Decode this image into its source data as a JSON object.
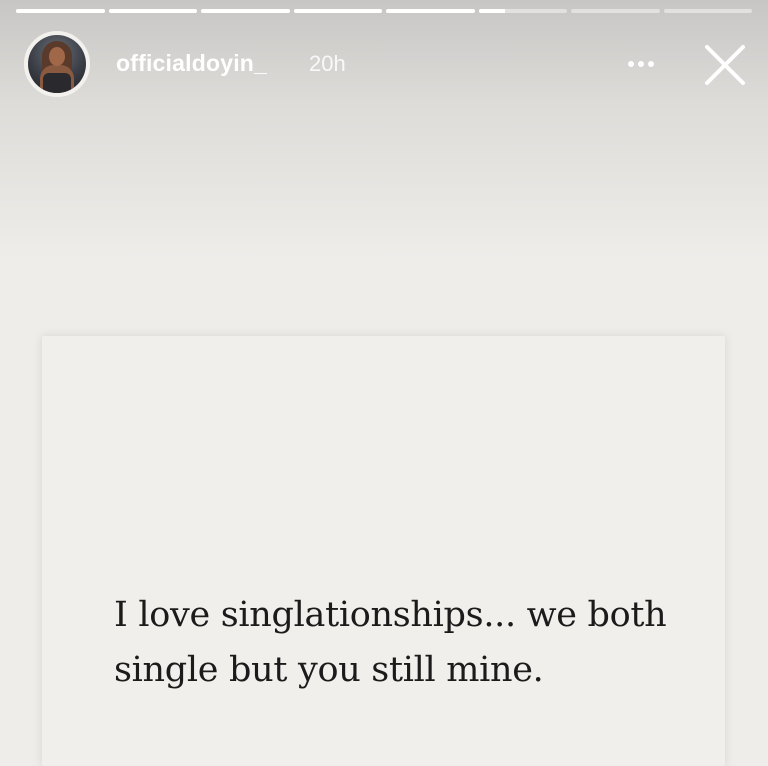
{
  "story": {
    "progress": {
      "segments": [
        1,
        1,
        1,
        1,
        1,
        0.3,
        0,
        0
      ],
      "bar_color": "#ffffff"
    },
    "header": {
      "avatar_icon": "profile-photo-icon",
      "username": "officialdoyin_",
      "timestamp": "20h",
      "more_icon": "ellipsis-icon",
      "close_icon": "close-icon"
    },
    "post": {
      "line1": "I love singlationships... we both",
      "line2": "single but you still mine."
    }
  }
}
